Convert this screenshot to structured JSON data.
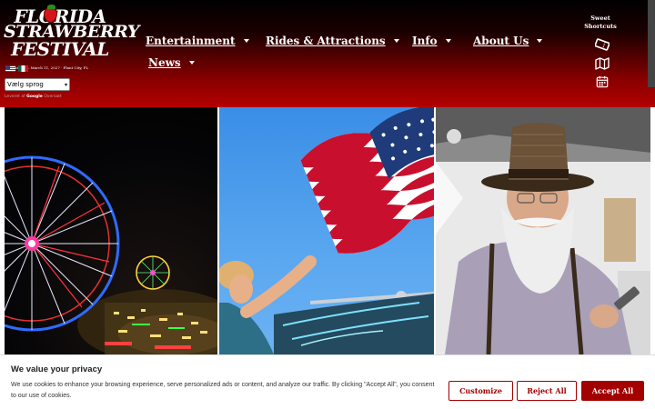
{
  "logo": {
    "line1": "FLORIDA",
    "line2": "STRAWBERRY",
    "line3": "FESTIVAL",
    "dates": "March 1 – March 11, 2027 · Plant City, FL"
  },
  "language": {
    "selected": "Vælg sprog",
    "powered_prefix": "Leveret af",
    "powered_brand": "Google",
    "powered_suffix": "Oversæt"
  },
  "nav": {
    "items": [
      {
        "label": "Entertainment"
      },
      {
        "label": "Rides & Attractions"
      },
      {
        "label": "Info"
      },
      {
        "label": "About Us"
      },
      {
        "label": "News"
      }
    ]
  },
  "shortcuts": {
    "title_line1": "Sweet",
    "title_line2": "Shortcuts",
    "icons": [
      "ticket-icon",
      "map-icon",
      "calendar-icon"
    ]
  },
  "cookie": {
    "title": "We value your privacy",
    "text": "We use cookies to enhance your browsing experience, serve personalized ads or content, and analyze our traffic. By clicking \"Accept All\", you consent to our use of cookies.",
    "customize": "Customize",
    "reject": "Reject All",
    "accept": "Accept All"
  },
  "colors": {
    "brand_red": "#a30000",
    "header_dark": "#000000"
  }
}
